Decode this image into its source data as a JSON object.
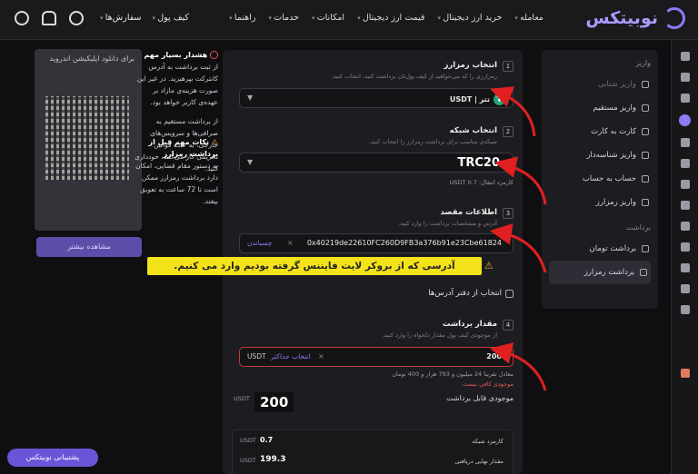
{
  "header": {
    "logo_text": "نوبیتکس",
    "nav": [
      "معامله",
      "خرید ارز دیجیتال",
      "قیمت ارز دیجیتال",
      "امکانات",
      "خدمات",
      "راهنما"
    ],
    "left_nav": [
      "سفارش‌ها",
      "کیف پول"
    ]
  },
  "menu": {
    "deposit_header": "واریز",
    "deposit_items": [
      "واریز شتابی",
      "واریز مستقیم",
      "کارت به کارت",
      "واریز شناسه‌دار",
      "حساب به حساب",
      "واریز رمزارز"
    ],
    "withdraw_header": "برداشت",
    "withdraw_items": [
      "برداشت تومان",
      "برداشت رمزارز"
    ]
  },
  "steps": {
    "s1": {
      "num": "1",
      "title": "انتخاب رمزارز",
      "sub": "رمزارزی را که می‌خواهید از کیف پول‌تان برداشت کنید، انتخاب کنید.",
      "token": "تتر | USDT"
    },
    "s2": {
      "num": "2",
      "title": "انتخاب شبکه",
      "sub": "شبکه‌ی مناسب برای برداشت رمزارز را انتخاب کنید.",
      "network": "TRC20",
      "fee": "کارمزد انتقال: 0.7 USDT"
    },
    "s3": {
      "num": "3",
      "title": "اطلاعات مقصد",
      "sub": "آدرس و مشخصات برداشت را وارد کنید.",
      "address": "0x40219de22610FC260D9FB3a376b91e23Cbe61824",
      "paste": "چسباندن",
      "address_book": "انتخاب از دفتر آدرس‌ها"
    },
    "s4": {
      "num": "4",
      "title": "مقدار برداشت",
      "sub": "از موجودی کیف پول مقدار دلخواه را وارد کنید.",
      "amount": "200",
      "unit": "USDT",
      "max": "انتخاب حداکثر",
      "approx": "معادل تقریبا 24 میلیون و 793 هزار و 400 تومان",
      "insufficient": "موجودی کافی نیست.",
      "withdrawable_label": "موجودی قابل برداشت",
      "withdrawable_value": "200",
      "withdrawable_unit": "USDT"
    }
  },
  "summary": {
    "fee_label": "کارمزد شبکه",
    "fee_value": "0.7",
    "fee_unit": "USDT",
    "final_label": "مقدار نهایی دریافتی",
    "final_value": "199.3",
    "final_unit": "USDT"
  },
  "callout": "آدرسی که از بروکر لایت فایننس  گرفته بودیم وارد می کنیم.",
  "side": {
    "app_title": "برای دانلود اپلیکیشن اندروید",
    "more_btn": "مشاهده بیشتر",
    "warn1_title": "هشدار بسیار مهم",
    "warn1_text": "از ثبت برداشت به آدرس کانترکت بپرهیزید. در غیر این صورت هزینه‌ی مازاد بر عهده‌ی کاربر خواهد بود.",
    "warn1_text2": "از برداشت مستقیم به صرافی‌ها و سرویس‌های خارجی، به علت قوانین تحریمی کار می‌کنند، خودداری کنید.",
    "warn2_title": "نکات مهم قبل از برداشت رمزارز",
    "warn2_text": "به دستور مقام قضایی، امکان دارد برداشت رمزارز ممکن است تا 72 ساعت به تعویق بیفتد."
  },
  "support": "پشتیبانی نوبیتکس",
  "colors": {
    "accent": "#8b7cf6",
    "callout": "#f4e21a",
    "arrow": "#e02020"
  }
}
